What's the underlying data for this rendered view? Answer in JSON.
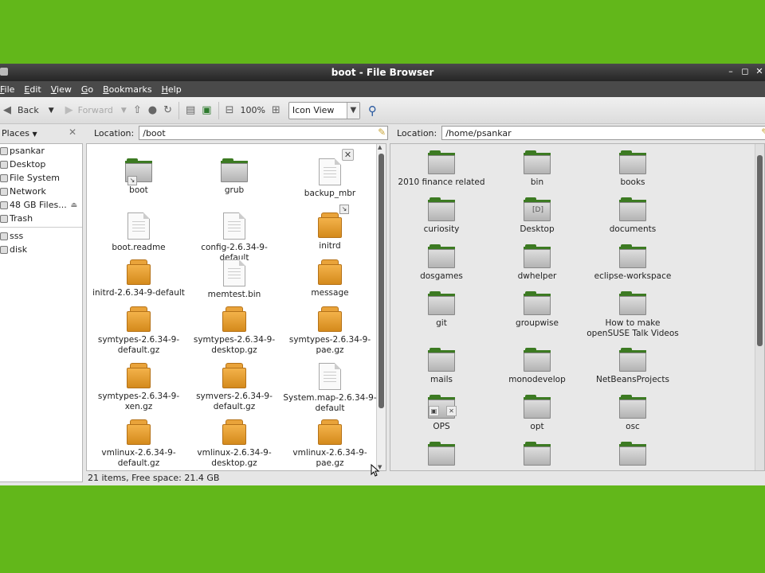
{
  "window": {
    "title": "boot - File Browser"
  },
  "menubar": {
    "items": [
      {
        "ul": "F",
        "rest": "ile"
      },
      {
        "ul": "E",
        "rest": "dit"
      },
      {
        "ul": "V",
        "rest": "iew"
      },
      {
        "ul": "G",
        "rest": "o"
      },
      {
        "ul": "B",
        "rest": "ookmarks"
      },
      {
        "ul": "H",
        "rest": "elp"
      }
    ]
  },
  "toolbar": {
    "back_label": "Back",
    "forward_label": "Forward",
    "zoom_label": "100%",
    "view_mode": "Icon View"
  },
  "sidebar": {
    "header": "Places",
    "items": [
      "psankar",
      "Desktop",
      "File System",
      "Network",
      "48 GB Files..."
    ],
    "trash": "Trash",
    "bookmarks": [
      "sss",
      "disk"
    ]
  },
  "left_pane": {
    "location_label": "Location:",
    "location_value": "/boot",
    "items": [
      {
        "name": "boot",
        "type": "folder-link"
      },
      {
        "name": "grub",
        "type": "folder"
      },
      {
        "name": "backup_mbr",
        "type": "doc-x"
      },
      {
        "name": "boot.readme",
        "type": "doc"
      },
      {
        "name": "config-2.6.34-9-default",
        "type": "doc"
      },
      {
        "name": "initrd",
        "type": "pkg-link"
      },
      {
        "name": "initrd-2.6.34-9-default",
        "type": "pkg"
      },
      {
        "name": "memtest.bin",
        "type": "doc"
      },
      {
        "name": "message",
        "type": "pkg"
      },
      {
        "name": "symtypes-2.6.34-9-default.gz",
        "type": "pkg"
      },
      {
        "name": "symtypes-2.6.34-9-desktop.gz",
        "type": "pkg"
      },
      {
        "name": "symtypes-2.6.34-9-pae.gz",
        "type": "pkg"
      },
      {
        "name": "symtypes-2.6.34-9-xen.gz",
        "type": "pkg"
      },
      {
        "name": "symvers-2.6.34-9-default.gz",
        "type": "pkg"
      },
      {
        "name": "System.map-2.6.34-9-default",
        "type": "doc"
      },
      {
        "name": "vmlinux-2.6.34-9-default.gz",
        "type": "pkg"
      },
      {
        "name": "vmlinux-2.6.34-9-desktop.gz",
        "type": "pkg"
      },
      {
        "name": "vmlinux-2.6.34-9-pae.gz",
        "type": "pkg"
      }
    ]
  },
  "right_pane": {
    "location_label": "Location:",
    "location_value": "/home/psankar",
    "items": [
      {
        "name": "2010 finance related",
        "type": "folder"
      },
      {
        "name": "bin",
        "type": "folder"
      },
      {
        "name": "books",
        "type": "folder"
      },
      {
        "name": "curiosity",
        "type": "folder"
      },
      {
        "name": "Desktop",
        "type": "folder-desktop"
      },
      {
        "name": "documents",
        "type": "folder"
      },
      {
        "name": "dosgames",
        "type": "folder"
      },
      {
        "name": "dwhelper",
        "type": "folder"
      },
      {
        "name": "eclipse-workspace",
        "type": "folder"
      },
      {
        "name": "git",
        "type": "folder"
      },
      {
        "name": "groupwise",
        "type": "folder"
      },
      {
        "name": "How to make openSUSE Talk Videos",
        "type": "folder"
      },
      {
        "name": "mails",
        "type": "folder"
      },
      {
        "name": "monodevelop",
        "type": "folder"
      },
      {
        "name": "NetBeansProjects",
        "type": "folder"
      },
      {
        "name": "OPS",
        "type": "folder-locked"
      },
      {
        "name": "opt",
        "type": "folder"
      },
      {
        "name": "osc",
        "type": "folder"
      },
      {
        "name": "",
        "type": "folder"
      },
      {
        "name": "",
        "type": "folder"
      },
      {
        "name": "",
        "type": "folder"
      }
    ]
  },
  "status": {
    "text": "21 items, Free space: 21.4 GB"
  }
}
